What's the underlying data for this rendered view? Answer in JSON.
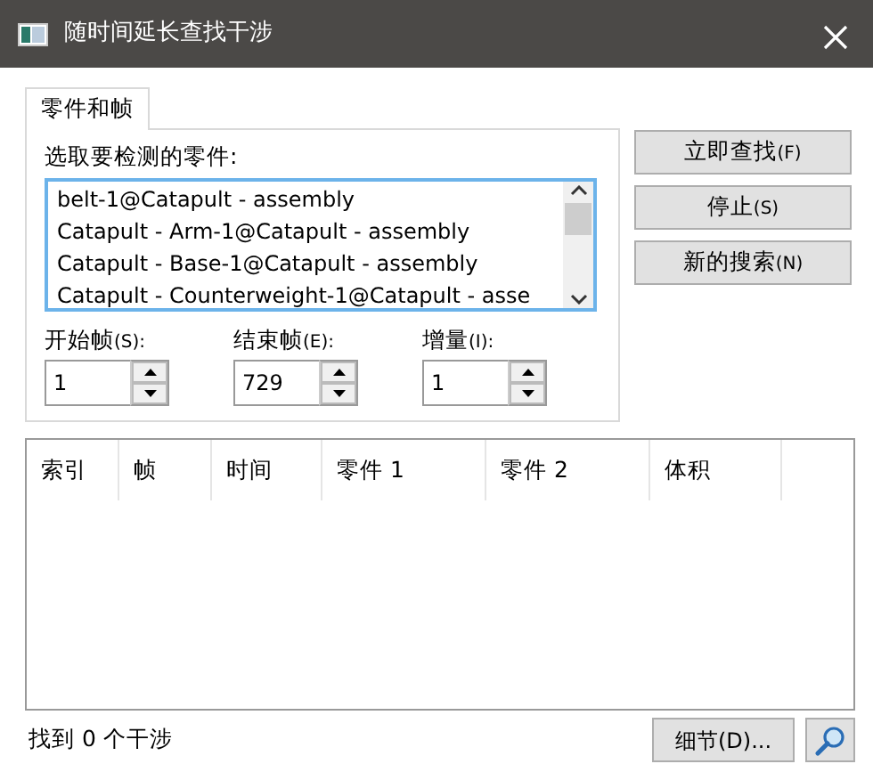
{
  "window": {
    "title": "随时间延长查找干涉"
  },
  "tabs": [
    {
      "label": "零件和帧",
      "selected": true
    }
  ],
  "parts": {
    "label": "选取要检测的零件:",
    "items": [
      {
        "text": "belt-1@Catapult - assembly",
        "selected": false
      },
      {
        "text": "Catapult - Arm-1@Catapult - assembly",
        "selected": false
      },
      {
        "text": "Catapult - Base-1@Catapult - assembly",
        "selected": false
      },
      {
        "text": "Catapult - Counterweight-1@Catapult - asse",
        "selected": false
      }
    ]
  },
  "spinners": [
    {
      "label": "开始帧",
      "mnemonic": "(S):",
      "value": "1"
    },
    {
      "label": "结束帧",
      "mnemonic": "(E):",
      "value": "729"
    },
    {
      "label": "增量",
      "mnemonic": "(I):",
      "value": "1"
    }
  ],
  "buttons": [
    {
      "label": "立即查找",
      "mnemonic": "(F)"
    },
    {
      "label": "停止",
      "mnemonic": "(S)"
    },
    {
      "label": "新的搜索",
      "mnemonic": "(N)"
    }
  ],
  "table": {
    "columns": [
      "索引",
      "帧",
      "时间",
      "零件 1",
      "零件 2",
      "体积"
    ]
  },
  "status_bar": {
    "text": "找到 0 个干涉",
    "details_button": "细节(D)..."
  }
}
